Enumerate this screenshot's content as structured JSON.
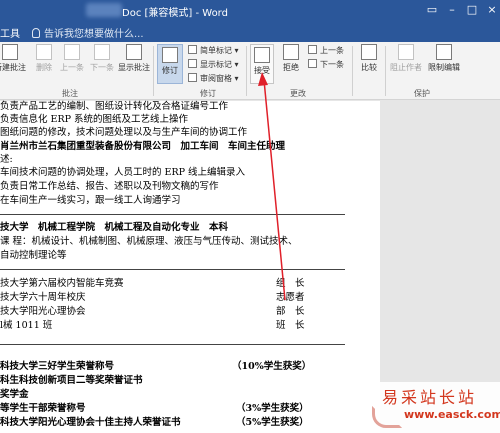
{
  "titlebar": {
    "title": "Doc [兼容模式] - Word",
    "window_controls": [
      "restore",
      "minimize",
      "maximize",
      "close"
    ],
    "bg_color": "#2b579a"
  },
  "tabbar": {
    "tools_label": "工具",
    "tell_me_placeholder": "告诉我您想要做什么..."
  },
  "ribbon": {
    "comments_group": {
      "label": "批注",
      "buttons": [
        {
          "label": "新建批注",
          "icon": "new-comment-icon",
          "enabled": true
        },
        {
          "label": "删除",
          "icon": "delete-comment-icon",
          "enabled": false
        },
        {
          "label": "上一条",
          "icon": "previous-comment-icon",
          "enabled": false
        },
        {
          "label": "下一条",
          "icon": "next-comment-icon",
          "enabled": false
        },
        {
          "label": "显示批注",
          "icon": "show-comments-icon",
          "enabled": true
        }
      ]
    },
    "tracking_group": {
      "label": "修订",
      "track_changes_label": "修订",
      "markup_select_value": "简单标记",
      "show_markup_label": "显示标记",
      "reviewing_pane_label": "审阅窗格"
    },
    "changes_group": {
      "label": "更改",
      "accept_label": "接受",
      "reject_label": "拒绝",
      "previous_label": "上一条",
      "next_label": "下一条"
    },
    "compare_group": {
      "compare_label": "比较"
    },
    "protect_group": {
      "label": "保护",
      "block_authors_label": "阻止作者",
      "restrict_editing_label": "限制编辑"
    }
  },
  "document": {
    "lines": [
      "负责产品工艺的编制、图纸设计转化及合格证编号工作",
      "负责信息化 ERP 系统的图纸及工艺线上操作",
      "图纸问题的修改，技术问题处理以及与生产车间的协调工作",
      "肖兰州市兰石集团重型装备股份有限公司　加工车间　车间主任助理",
      "述:",
      "车间技术问题的协调处理，人员工时的 ERP 线上编辑录入",
      "负责日常工作总结、报告、述职以及刊物文稿的写作",
      "在车间生产一线实习，跟一线工人询通学习",
      "技大学　机械工程学院　机械工程及自动化专业　本科",
      "课 程：机械设计、机械制图、机械原理、液压与气压传动、测试技术、",
      "自动控制理论等",
      "技大学第六届校内智能车竞赛",
      "技大学六十周年校庆",
      "技大学阳光心理协会",
      "l械 1011 班",
      "科技大学三好学生荣誉称号",
      "科生科技创新项目二等奖荣誉证书",
      "奖学金",
      "等学生干部荣誉称号",
      "科技大学阳光心理协会十佳主持人荣誉证书"
    ],
    "roles": [
      "组　长",
      "志愿者",
      "部　长",
      "班　长"
    ],
    "ratios": [
      "（10%学生获奖）",
      "（3%学生获奖）",
      "（5%学生获奖）"
    ]
  },
  "watermark": {
    "text": "易采站长站",
    "url": "www.easck.com"
  }
}
